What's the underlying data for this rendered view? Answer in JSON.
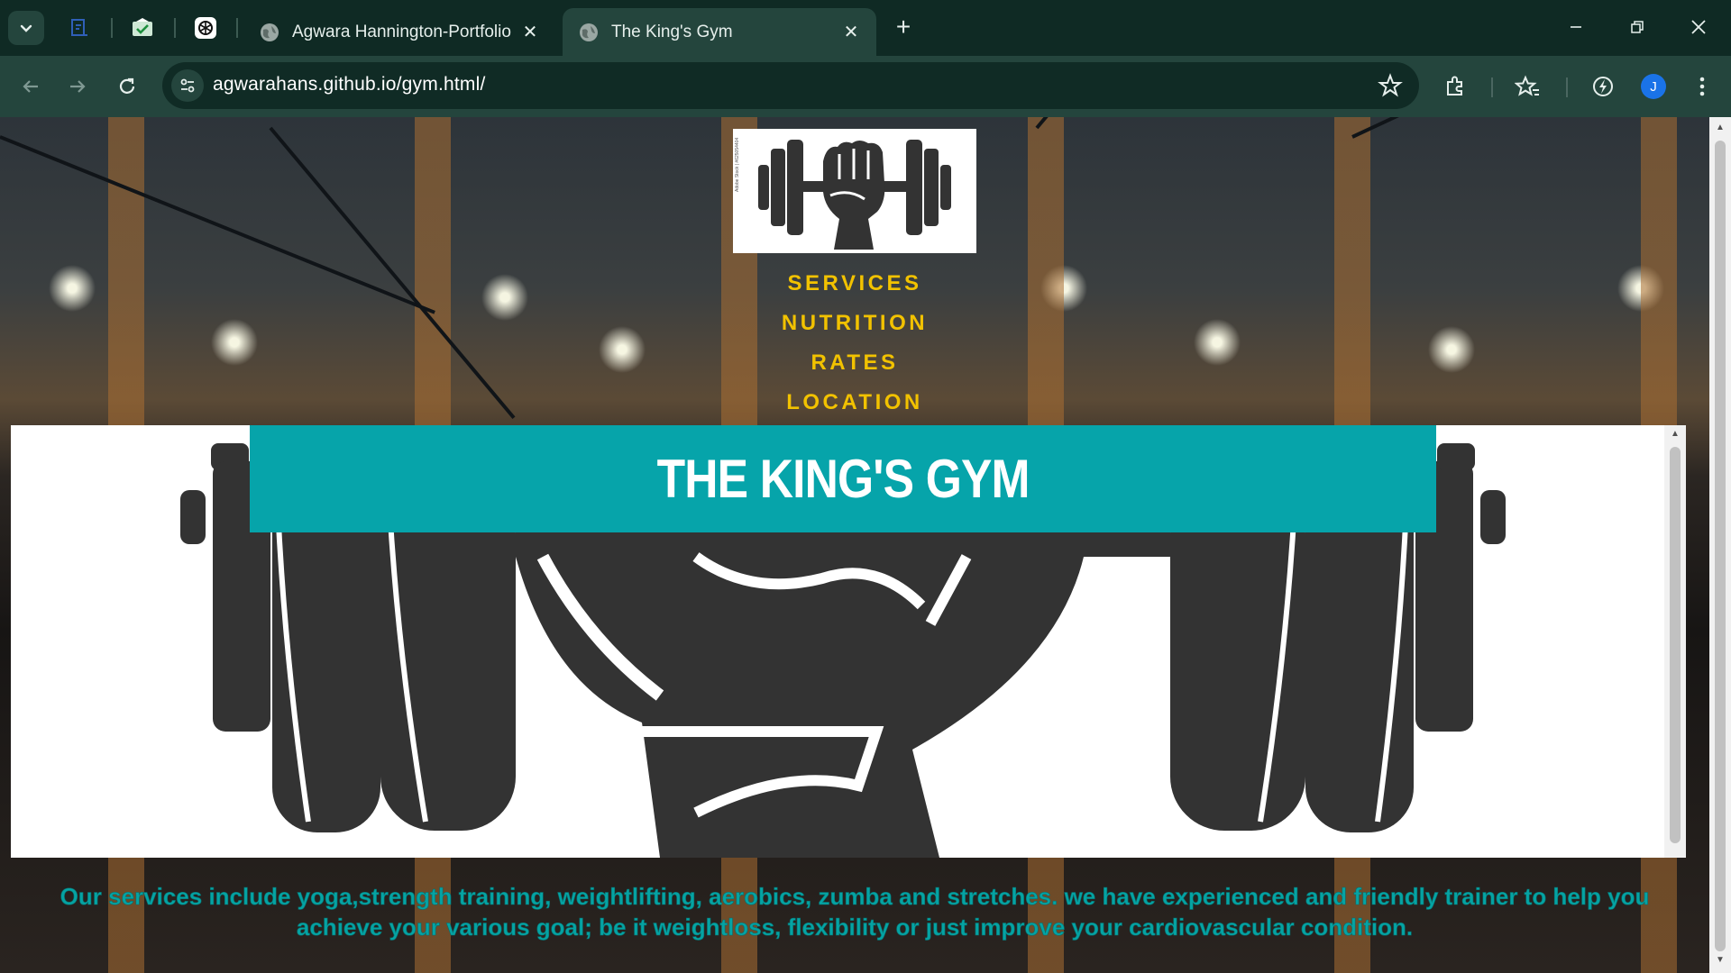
{
  "browser": {
    "tabs": [
      {
        "title": "Agwara Hannington-Portfolio",
        "active": false
      },
      {
        "title": "The King's Gym",
        "active": true
      }
    ],
    "url": "agwarahans.github.io/gym.html/",
    "profile_initial": "J",
    "colors": {
      "frame": "#0f2a24",
      "toolbar": "#24453d",
      "avatar": "#1a73e8"
    }
  },
  "page": {
    "nav": [
      "SERVICES",
      "NUTRITION",
      "RATES",
      "LOCATION"
    ],
    "hero_title": "THE KING'S GYM",
    "logo_credit": "Adobe Stock | #625054404",
    "services_text": "Our services include yoga,strength training, weightlifting, aerobics, zumba and stretches. we have experienced and friendly trainer to help you achieve your various goal; be it weightloss, flexibility or just improve your cardiovascular condition.",
    "colors": {
      "nav": "#f2c200",
      "banner": "#06a4aa",
      "services_text": "#05a3a3"
    }
  }
}
